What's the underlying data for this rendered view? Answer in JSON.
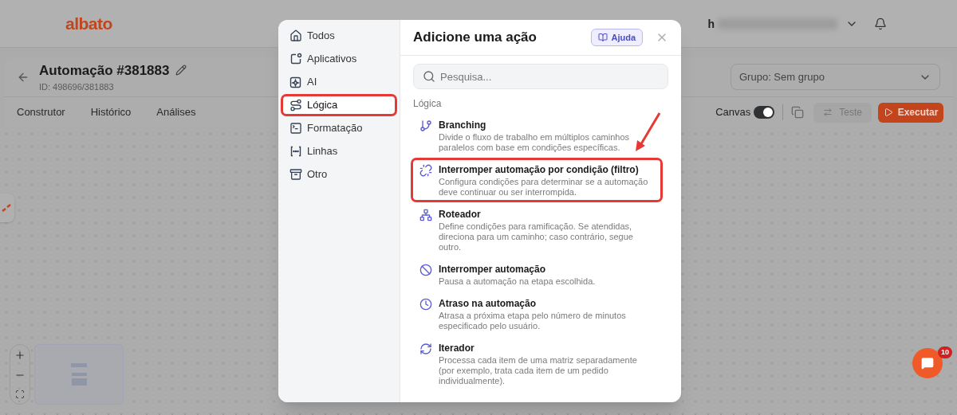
{
  "header": {
    "logo": "albato",
    "user": "h"
  },
  "automation": {
    "title": "Automação #381883",
    "id": "ID: 498696/381883",
    "group_select": "Grupo: Sem grupo"
  },
  "tabs": [
    {
      "label": "Construtor"
    },
    {
      "label": "Histórico"
    },
    {
      "label": "Análises"
    }
  ],
  "toolbar": {
    "canvas_label": "Canvas",
    "canvas_on": true,
    "test_button": "Teste",
    "test_disabled": true,
    "run_button": "Executar"
  },
  "chat": {
    "badge": "10"
  },
  "modal": {
    "title": "Adicione uma ação",
    "help_button": "Ajuda",
    "search_placeholder": "Pesquisa...",
    "section": "Lógica",
    "categories": [
      {
        "label": "Todos",
        "kind": "home",
        "selected": false,
        "highlighted": false
      },
      {
        "label": "Aplicativos",
        "kind": "apps",
        "selected": false,
        "highlighted": false
      },
      {
        "label": "AI",
        "kind": "ai",
        "selected": false,
        "highlighted": false
      },
      {
        "label": "Lógica",
        "kind": "logic",
        "selected": true,
        "highlighted": true
      },
      {
        "label": "Formatação",
        "kind": "format",
        "selected": false,
        "highlighted": false
      },
      {
        "label": "Linhas",
        "kind": "lines",
        "selected": false,
        "highlighted": false
      },
      {
        "label": "Otro",
        "kind": "other",
        "selected": false,
        "highlighted": false
      }
    ],
    "actions": [
      {
        "title": "Branching",
        "description": "Divide o fluxo de trabalho em múltiplos caminhos paralelos com base em condições específicas.",
        "kind": "branch",
        "highlighted": false
      },
      {
        "title": "Interromper automação por condição (filtro)",
        "description": "Configura condições para determinar se a automação deve continuar ou ser interrompida.",
        "kind": "filter",
        "highlighted": true
      },
      {
        "title": "Roteador",
        "description": "Define condições para ramificação. Se atendidas, direciona para um caminho; caso contrário, segue outro.",
        "kind": "router",
        "highlighted": false
      },
      {
        "title": "Interromper automação",
        "description": "Pausa a automação na etapa escolhida.",
        "kind": "stop",
        "highlighted": false
      },
      {
        "title": "Atraso na automação",
        "description": "Atrasa a próxima etapa pelo número de minutos especificado pelo usuário.",
        "kind": "delay",
        "highlighted": false
      },
      {
        "title": "Iterador",
        "description": "Processa cada item de uma matriz separadamente (por exemplo, trata cada item de um pedido individualmente).",
        "kind": "iterate",
        "highlighted": false
      }
    ]
  }
}
